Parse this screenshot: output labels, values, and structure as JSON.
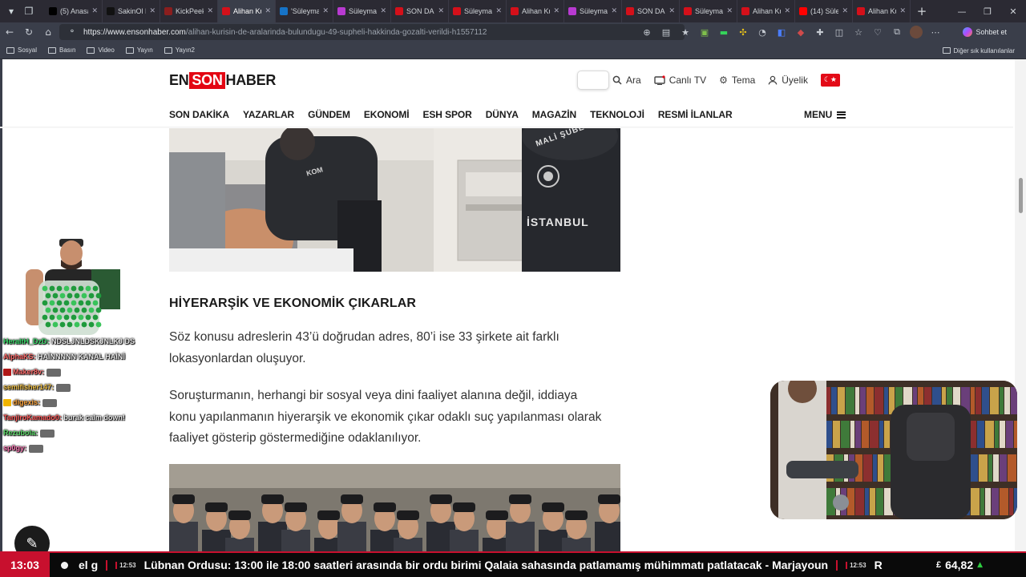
{
  "browser": {
    "tabs": [
      {
        "title": "(5) Anasa",
        "favicon_color": "#000000",
        "active": false
      },
      {
        "title": "SakinOl H",
        "favicon_color": "#111111",
        "active": false
      },
      {
        "title": "KickPeek",
        "favicon_color": "#8b1e1e",
        "active": false
      },
      {
        "title": "Alihan Ku",
        "favicon_color": "#d4101a",
        "active": true
      },
      {
        "title": "'Süleyman",
        "favicon_color": "#1673c7",
        "active": false
      },
      {
        "title": "Süleyman",
        "favicon_color": "#b83ad1",
        "active": false
      },
      {
        "title": "SON DAK",
        "favicon_color": "#d4101a",
        "active": false
      },
      {
        "title": "Süleyman",
        "favicon_color": "#d4101a",
        "active": false
      },
      {
        "title": "Alihan Ku",
        "favicon_color": "#d4101a",
        "active": false
      },
      {
        "title": "Süleyman",
        "favicon_color": "#b83ad1",
        "active": false
      },
      {
        "title": "SON DAK",
        "favicon_color": "#d4101a",
        "active": false
      },
      {
        "title": "Süleyman",
        "favicon_color": "#d4101a",
        "active": false
      },
      {
        "title": "Alihan Ku",
        "favicon_color": "#d4101a",
        "active": false
      },
      {
        "title": "(14) Süley",
        "favicon_color": "#ff0000",
        "active": false
      },
      {
        "title": "Alihan Ku",
        "favicon_color": "#d4101a",
        "active": false
      }
    ],
    "url_host": "https://www.ensonhaber.com",
    "url_path": "/alihan-kurisin-de-aralarinda-bulundugu-49-supheli-hakkinda-gozalti-verildi-h1557112",
    "copilot_label": "Sohbet et",
    "bookmarks": [
      "Sosyal",
      "Basın",
      "Video",
      "Yayın",
      "Yayın2"
    ],
    "other_bookmarks": "Diğer sık kullanılanlar"
  },
  "site": {
    "logo": {
      "part1": "EN",
      "part2": "SON",
      "part3": "HABER"
    },
    "header_actions": {
      "search": "Ara",
      "live_tv": "Canlı TV",
      "theme": "Tema",
      "membership": "Üyelik"
    },
    "nav": [
      "SON DAKİKA",
      "YAZARLAR",
      "GÜNDEM",
      "EKONOMİ",
      "ESH SPOR",
      "DÜNYA",
      "MAGAZİN",
      "TEKNOLOJİ",
      "RESMİ İLANLAR"
    ],
    "menu_label": "MENU"
  },
  "article": {
    "photo1_badges": {
      "vest_front": "KOM",
      "vest_back_top": "MALİ ŞUBE",
      "vest_back_bottom": "İSTANBUL"
    },
    "heading": "HİYERARŞİK VE EKONOMİK ÇIKARLAR",
    "paragraph1": "Söz konusu adreslerin 43’ü doğrudan adres, 80’i ise 33 şirkete ait farklı lokasyonlardan oluşuyor.",
    "paragraph2": "Soruşturmanın, herhangi bir sosyal veya dini faaliyet alanına değil, iddiaya konu yapılanmanın hiyerarşik ve ekonomik çıkar odaklı suç yapılanması olarak faaliyet gösterip göstermediğine odaklanılıyor."
  },
  "chat": [
    {
      "user": "HeraltH_DzD:",
      "text": "NDSLJNLDSKJNLKJ DS",
      "user_color": "#3ad86a",
      "badge_color": null
    },
    {
      "user": "AlphaKS:",
      "text": "HAİNNNNN KANAL HAİNİ",
      "user_color": "#ff6b6b",
      "badge_color": null
    },
    {
      "user": "Maker8v:",
      "text": "",
      "user_color": "#ff6b6b",
      "badge_color": "#b01818"
    },
    {
      "user": "semifisher147:",
      "text": "",
      "user_color": "#f0c24a",
      "badge_color": null
    },
    {
      "user": "digexis:",
      "text": "",
      "user_color": "#ffa53a",
      "badge_color": "#f0b400"
    },
    {
      "user": "TanjiroKamado0:",
      "text": "burak calm down!",
      "user_color": "#ff5d5d",
      "badge_color": null
    },
    {
      "user": "Rezubola:",
      "text": "",
      "user_color": "#5ddc6a",
      "badge_color": null
    },
    {
      "user": "sp0gy:",
      "text": "",
      "user_color": "#ff7ab8",
      "badge_color": null
    }
  ],
  "ticker": {
    "clock": "13:03",
    "prefix_fragment": "el g",
    "stamp1": "12:53",
    "headline": "Lübnan Ordusu: 13:00 ile 18:00 saatleri arasında bir ordu birimi Qalaia sahasında patlamamış mühimmatı patlatacak - Marjayoun",
    "stamp2": "12:53",
    "suffix_fragment": "R",
    "currency_symbol": "£",
    "price": "64,82",
    "trend": "up",
    "trend_color": "#2ecc40"
  }
}
